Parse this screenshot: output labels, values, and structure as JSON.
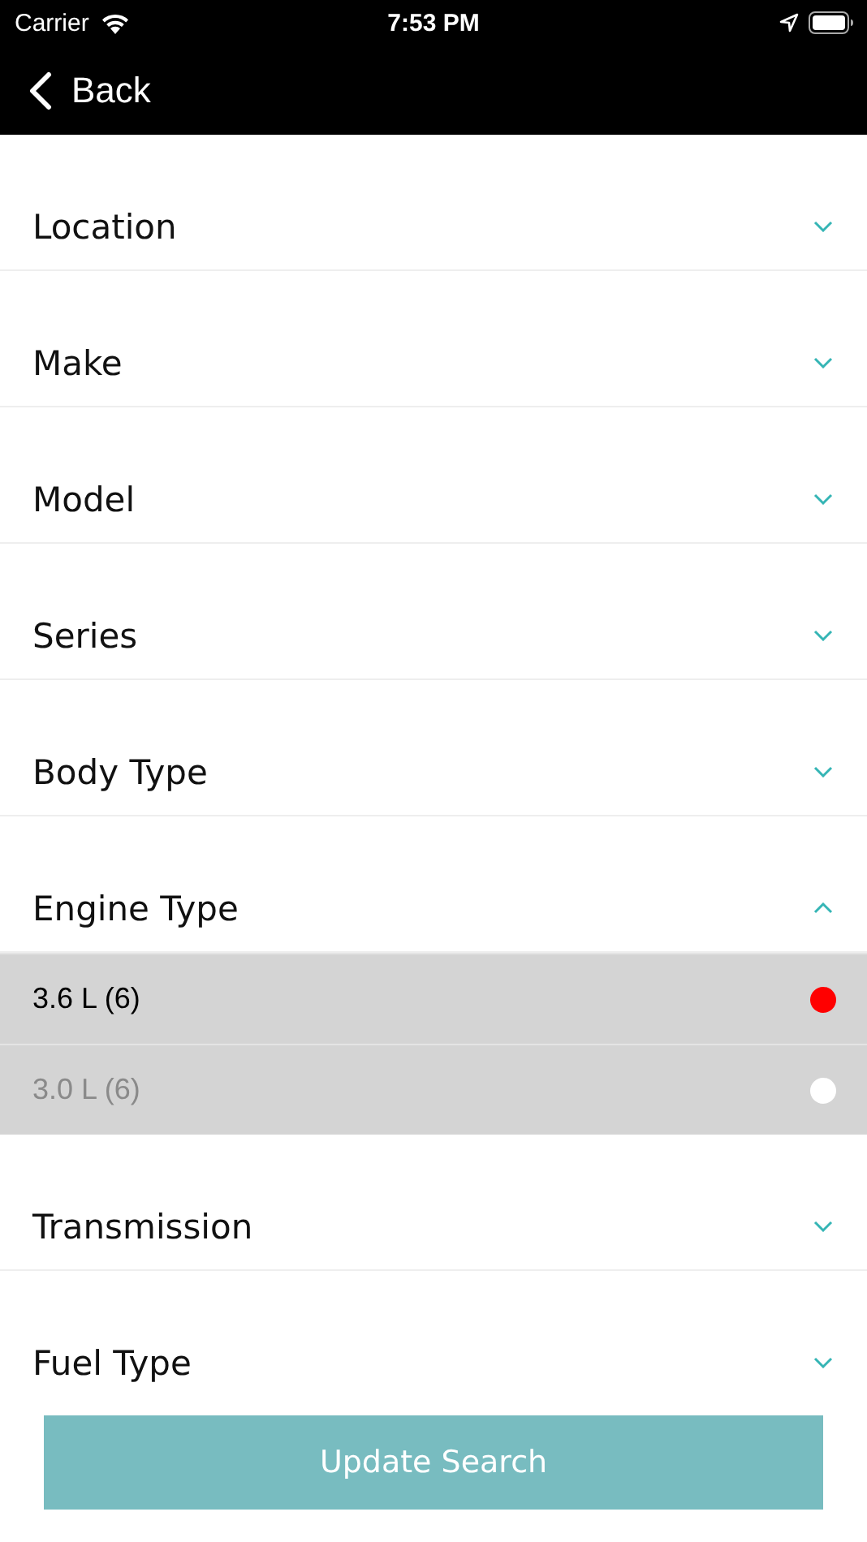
{
  "status_bar": {
    "carrier": "Carrier",
    "time": "7:53 PM"
  },
  "nav": {
    "back": "Back"
  },
  "sections": [
    {
      "label": "Location",
      "expanded": false
    },
    {
      "label": "Make",
      "expanded": false
    },
    {
      "label": "Model",
      "expanded": false
    },
    {
      "label": "Series",
      "expanded": false
    },
    {
      "label": "Body Type",
      "expanded": false
    },
    {
      "label": "Engine Type",
      "expanded": true,
      "options": [
        {
          "label": "3.6 L (6)",
          "selected": true
        },
        {
          "label": "3.0 L (6)",
          "selected": false
        }
      ]
    },
    {
      "label": "Transmission",
      "expanded": false
    },
    {
      "label": "Fuel Type",
      "expanded": false
    }
  ],
  "button": "Update Search"
}
